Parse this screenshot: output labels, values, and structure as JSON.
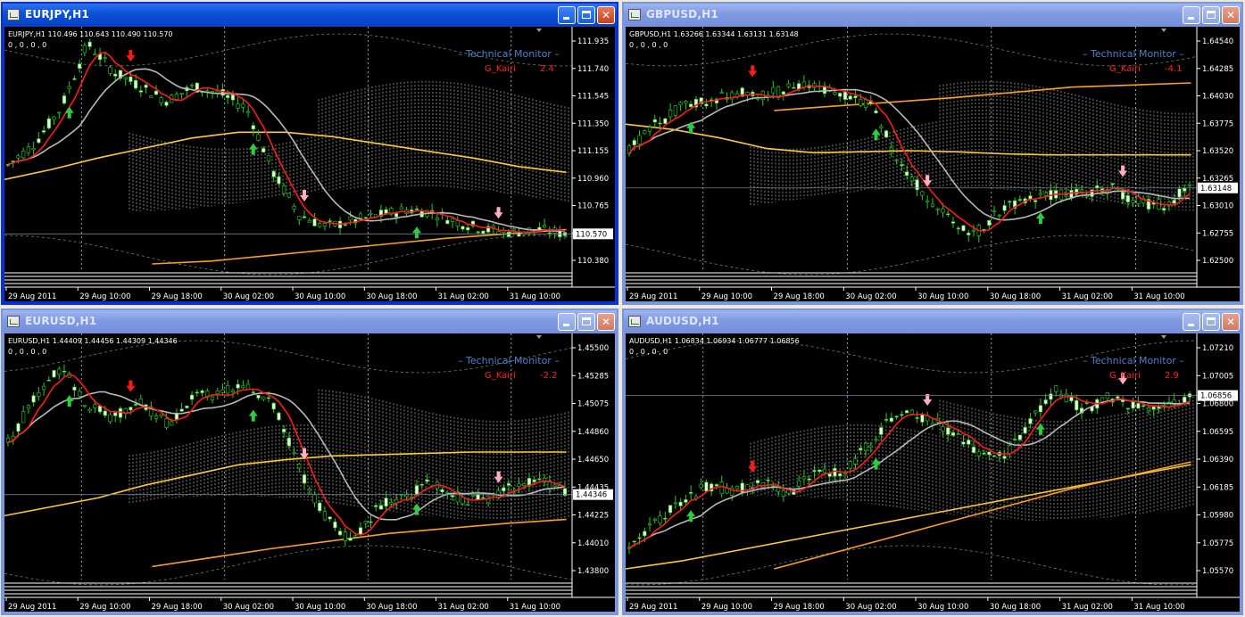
{
  "windows": [
    {
      "id": "eurjpy",
      "title": "EURJPY,H1",
      "active": true,
      "info_line1": "EURJPY,H1  110.496 110.643 110.490 110.570",
      "info_line2": "0 , 0 , 0 , 0",
      "monitor_label": "– Technical  Monitor –",
      "kairi_label": "G_Kairi",
      "kairi_value": "2.4",
      "price_labels": [
        "111.935",
        "111.740",
        "111.545",
        "111.350",
        "111.155",
        "110.960",
        "110.765",
        "110.570",
        "110.380"
      ],
      "current_price": "110.570",
      "time_labels": [
        "29 Aug 2011",
        "29 Aug 10:00",
        "29 Aug 18:00",
        "30 Aug 02:00",
        "30 Aug 10:00",
        "30 Aug 18:00",
        "31 Aug 02:00",
        "31 Aug 10:00"
      ],
      "price_top": 111.98,
      "price_bottom": 110.36,
      "current": 110.57,
      "path": [
        111.05,
        111.2,
        111.45,
        111.9,
        111.7,
        111.6,
        111.5,
        111.6,
        111.55,
        111.45,
        111.0,
        110.7,
        110.62,
        110.66,
        110.7,
        110.74,
        110.72,
        110.65,
        110.6,
        110.58,
        110.6,
        110.57
      ],
      "ma_slow": [
        110.95,
        111.02,
        111.1,
        111.17,
        111.24,
        111.28,
        111.28,
        111.25,
        111.2,
        111.15,
        111.1,
        111.04,
        111.0
      ],
      "ma_long": [
        110.36,
        110.38,
        110.42,
        110.46,
        110.5,
        110.54,
        110.57,
        110.6
      ]
    },
    {
      "id": "gbpusd",
      "title": "GBPUSD,H1",
      "active": false,
      "info_line1": "GBPUSD,H1  1.63266 1.63344 1.63131 1.63148",
      "info_line2": "0 , 0 , 0 , 0",
      "monitor_label": "– Technical  Monitor –",
      "kairi_label": "G_Kairi",
      "kairi_value": "-4.1",
      "price_labels": [
        "1.64540",
        "1.64285",
        "1.64030",
        "1.63775",
        "1.63520",
        "1.63265",
        "1.63010",
        "1.62755",
        "1.62500"
      ],
      "current_price": "1.63148",
      "time_labels": [
        "29 Aug 2011",
        "29 Aug 10:00",
        "29 Aug 18:00",
        "30 Aug 02:00",
        "30 Aug 10:00",
        "30 Aug 18:00",
        "31 Aug 02:00",
        "31 Aug 10:00"
      ],
      "price_top": 1.6462,
      "price_bottom": 1.6243,
      "current": 1.63148,
      "path": [
        1.6352,
        1.6375,
        1.6392,
        1.6398,
        1.6405,
        1.6402,
        1.6408,
        1.6412,
        1.6404,
        1.6395,
        1.6345,
        1.631,
        1.6285,
        1.6272,
        1.6295,
        1.6305,
        1.6308,
        1.631,
        1.6315,
        1.6302,
        1.6298,
        1.6315
      ],
      "ma_slow": [
        1.6375,
        1.637,
        1.6362,
        1.6352,
        1.6348,
        1.6349,
        1.635,
        1.6349,
        1.6347,
        1.6346,
        1.6346,
        1.6346,
        1.6346
      ],
      "ma_long": [
        1.6388,
        1.6392,
        1.6396,
        1.64,
        1.6405,
        1.641,
        1.6412,
        1.6414
      ]
    },
    {
      "id": "eurusd",
      "title": "EURUSD,H1",
      "active": false,
      "info_line1": "EURUSD,H1  1.44409 1.44456 1.44309 1.44346",
      "info_line2": "0 , 0 , 0 , 0",
      "monitor_label": "– Technical  Monitor –",
      "kairi_label": "G_Kairi",
      "kairi_value": "-2.2",
      "price_labels": [
        "1.45500",
        "1.45285",
        "1.45075",
        "1.44860",
        "1.44650",
        "1.44435",
        "1.44225",
        "1.44010",
        "1.43800"
      ],
      "current_price": "1.44346",
      "time_labels": [
        "29 Aug 2011",
        "29 Aug 10:00",
        "29 Aug 18:00",
        "30 Aug 02:00",
        "30 Aug 10:00",
        "30 Aug 18:00",
        "31 Aug 02:00",
        "31 Aug 10:00"
      ],
      "price_top": 1.4557,
      "price_bottom": 1.4372,
      "current": 1.44346,
      "path": [
        1.4475,
        1.451,
        1.4535,
        1.4505,
        1.4495,
        1.4508,
        1.449,
        1.451,
        1.4515,
        1.4518,
        1.4505,
        1.4455,
        1.4415,
        1.4398,
        1.4425,
        1.4435,
        1.4445,
        1.4432,
        1.443,
        1.444,
        1.4445,
        1.4437
      ],
      "ma_slow": [
        1.4418,
        1.4425,
        1.4432,
        1.4442,
        1.445,
        1.4458,
        1.4462,
        1.4465,
        1.4466,
        1.4467,
        1.4468,
        1.4468,
        1.4468
      ],
      "ma_long": [
        1.4378,
        1.4385,
        1.4392,
        1.4398,
        1.4404,
        1.4408,
        1.4412,
        1.4415
      ]
    },
    {
      "id": "audusd",
      "title": "AUDUSD,H1",
      "active": false,
      "info_line1": "AUDUSD,H1  1.06834 1.06934 1.06777 1.06856",
      "info_line2": "0 , 0 , 0 , 0",
      "monitor_label": "– Technical  Monitor –",
      "kairi_label": "G_Kairi",
      "kairi_value": "2.9",
      "price_labels": [
        "1.07210",
        "1.07005",
        "1.06800",
        "1.06595",
        "1.06390",
        "1.06185",
        "1.05980",
        "1.05775",
        "1.05570"
      ],
      "current_price": "1.06856",
      "time_labels": [
        "29 Aug 2011",
        "29 Aug 10:00",
        "29 Aug 18:00",
        "30 Aug 02:00",
        "30 Aug 10:00",
        "30 Aug 18:00",
        "31 Aug 02:00",
        "31 Aug 10:00"
      ],
      "price_top": 1.0728,
      "price_bottom": 1.0552,
      "current": 1.06856,
      "path": [
        1.0575,
        1.059,
        1.0608,
        1.0618,
        1.0615,
        1.062,
        1.0612,
        1.063,
        1.0628,
        1.065,
        1.0672,
        1.067,
        1.066,
        1.0645,
        1.064,
        1.0665,
        1.069,
        1.0675,
        1.0685,
        1.0678,
        1.068,
        1.0684
      ],
      "ma_slow": [
        1.0556,
        1.0562,
        1.057,
        1.0578,
        1.0586,
        1.0594,
        1.0602,
        1.061,
        1.0618,
        1.0626,
        1.0634
      ],
      "ma_long": [
        1.0556,
        1.0568,
        1.058,
        1.0592,
        1.0604,
        1.0616,
        1.0626,
        1.0636
      ]
    }
  ],
  "colors": {
    "bull_candle": "#e8ffd8",
    "bear_candle": "#000000",
    "wick": "#22cc22",
    "tenkan": "#ff1a1a",
    "kijun_ma": "#b8b8b8",
    "slow_ma": "#ffcc33",
    "long_ma": "#ffa020",
    "cloud": "#ffffff",
    "grid": "#e0e0e0",
    "up_arrow": "#2ecc40",
    "down_arrow_pink": "#ffb0c0",
    "down_arrow_red": "#ff1a1a"
  }
}
